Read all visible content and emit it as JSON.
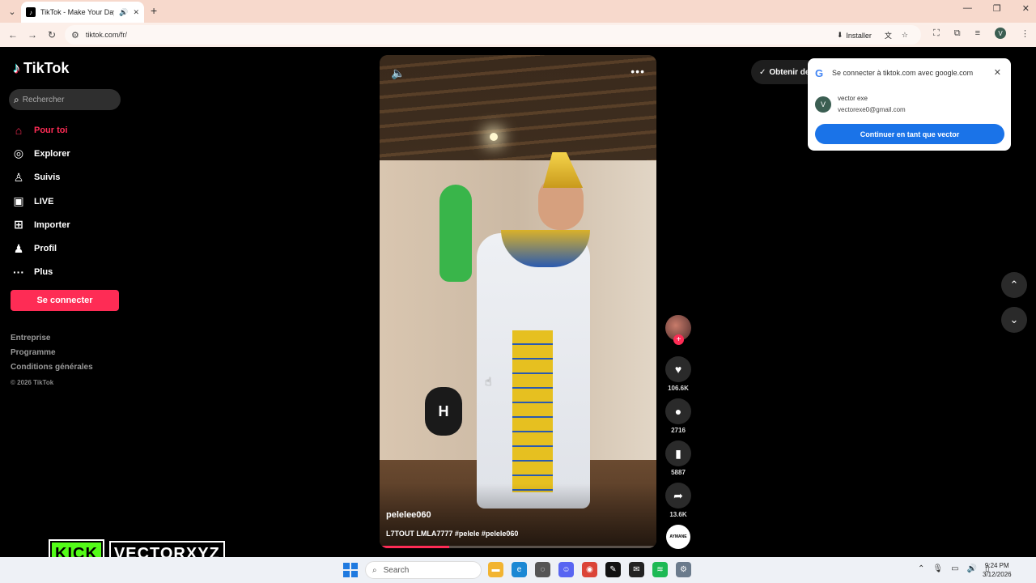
{
  "browser": {
    "tab_title": "TikTok - Make Your Day",
    "url": "tiktok.com/fr/",
    "install_label": "Installer",
    "profile_initial": "V"
  },
  "sidebar": {
    "logo": "TikTok",
    "search_placeholder": "Rechercher",
    "items": [
      {
        "label": "Pour toi",
        "icon": "home-icon",
        "active": true
      },
      {
        "label": "Explorer",
        "icon": "compass-icon"
      },
      {
        "label": "Suivis",
        "icon": "person-icon"
      },
      {
        "label": "LIVE",
        "icon": "live-icon"
      },
      {
        "label": "Importer",
        "icon": "plus-square-icon"
      },
      {
        "label": "Profil",
        "icon": "user-icon"
      },
      {
        "label": "Plus",
        "icon": "more-icon"
      }
    ],
    "login_label": "Se connecter",
    "footer": [
      "Entreprise",
      "Programme",
      "Conditions générales"
    ],
    "copyright": "© 2026 TikTok"
  },
  "video": {
    "author": "pelelee060",
    "caption": "L7TOUT LMLA7777 #pelele #pelele060",
    "progress": 0.25
  },
  "actions": {
    "likes": "106.6K",
    "comments": "2716",
    "saves": "5887",
    "shares": "13.6K",
    "music_label": "AYMANE"
  },
  "header": {
    "get_app_label": "Obtenir de"
  },
  "google_popup": {
    "title": "Se connecter à tiktok.com avec google.com",
    "account_initial": "V",
    "account_name": "vector exe",
    "account_email": "vectorexe0@gmail.com",
    "continue_label": "Continuer en tant que vector"
  },
  "overlay": {
    "kick": "KICK",
    "handle": "VECTORXYZ"
  },
  "taskbar": {
    "search_label": "Search",
    "time": "9:24 PM",
    "date": "3/12/2026"
  }
}
